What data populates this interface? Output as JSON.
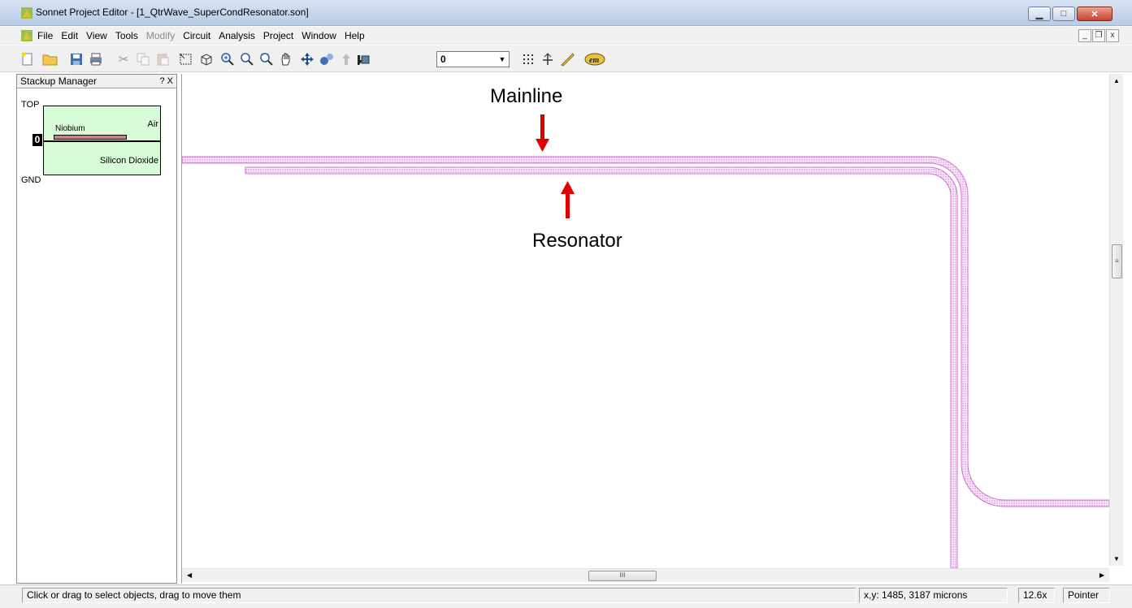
{
  "window": {
    "title": "Sonnet Project Editor - [1_QtrWave_SuperCondResonator.son]",
    "minimize": "▁",
    "maximize": "□",
    "close": "✕"
  },
  "menu": {
    "items": [
      "File",
      "Edit",
      "View",
      "Tools",
      "Modify",
      "Circuit",
      "Analysis",
      "Project",
      "Window",
      "Help"
    ],
    "mdi_minimize": "_",
    "mdi_restore": "❐",
    "mdi_close": "x"
  },
  "toolbar": {
    "icons": [
      "new-project-icon",
      "open-icon",
      "save-icon",
      "print-icon",
      "cut-icon",
      "copy-icon",
      "paste-icon",
      "select-icon",
      "view-3d-icon",
      "zoom-in-icon",
      "zoom-out-icon",
      "zoom-area-icon",
      "pan-icon",
      "move-icon",
      "layer-icon",
      "up-level-icon",
      "down-level-icon",
      "grid-icon",
      "snap-icon",
      "measure-icon",
      "em-icon"
    ],
    "level_value": "0"
  },
  "stackup": {
    "header": "Stackup Manager",
    "header_controls": "? X",
    "top_label": "TOP",
    "gnd_label": "GND",
    "level": "0",
    "layer_upper": "Air",
    "metal": "Niobium",
    "layer_lower": "Silicon Dioxide"
  },
  "canvas": {
    "annotation_mainline": "Mainline",
    "annotation_resonator": "Resonator",
    "trace_color": "#d070d0",
    "arrow_color": "#e00000"
  },
  "statusbar": {
    "message": "Click or drag to select objects, drag to move them",
    "coords": "x,y:  1485,  3187 microns",
    "zoom": "12.6x",
    "mode": "Pointer"
  },
  "scrollbar": {
    "hthumb_grip": "III",
    "vthumb_grip": "≡"
  }
}
